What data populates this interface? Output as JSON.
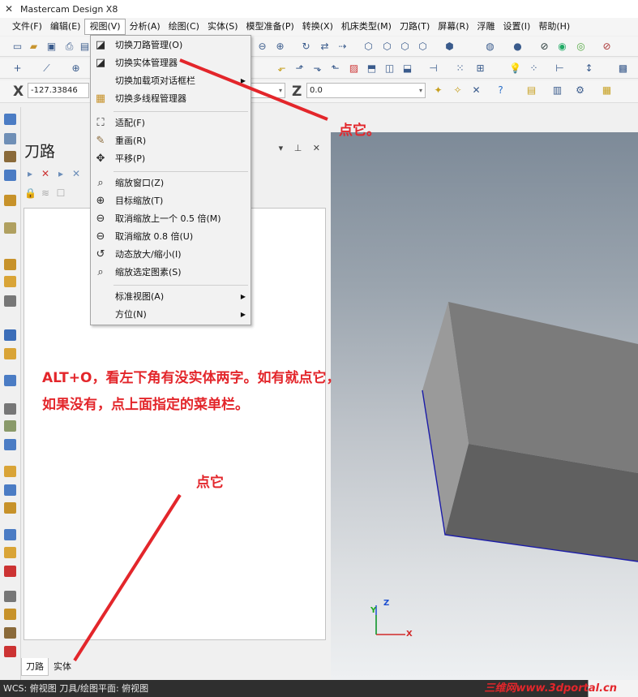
{
  "app": {
    "title": "Mastercam Design X8",
    "icon": "mastercam-x-icon"
  },
  "menu": [
    "文件(F)",
    "编辑(E)",
    "视图(V)",
    "分析(A)",
    "绘图(C)",
    "实体(S)",
    "模型准备(P)",
    "转换(X)",
    "机床类型(M)",
    "刀路(T)",
    "屏幕(R)",
    "浮雕",
    "设置(I)",
    "帮助(H)"
  ],
  "coords": {
    "x_label": "X",
    "x_value": "-127.33846",
    "z_label": "Z",
    "z_value": "0.0"
  },
  "view_menu": {
    "items": [
      {
        "label": "切换刀路管理(O)",
        "icon": "toolpath-manager-icon"
      },
      {
        "label": "切换实体管理器",
        "icon": "solids-manager-icon"
      },
      {
        "label": "切换加载项对话框栏",
        "icon": "",
        "submenu": true
      },
      {
        "label": "切换多线程管理器",
        "icon": "multithread-manager-icon"
      },
      {
        "label": "适配(F)",
        "icon": "fit-icon"
      },
      {
        "label": "重画(R)",
        "icon": "repaint-icon"
      },
      {
        "label": "平移(P)",
        "icon": "pan-icon"
      },
      {
        "label": "缩放窗口(Z)",
        "icon": "zoom-window-icon"
      },
      {
        "label": "目标缩放(T)",
        "icon": "zoom-target-icon"
      },
      {
        "label": "取消缩放上一个 0.5 倍(M)",
        "icon": "unzoom-previous-icon"
      },
      {
        "label": "取消缩放 0.8 倍(U)",
        "icon": "unzoom-icon"
      },
      {
        "label": "动态放大/缩小(I)",
        "icon": "dynamic-zoom-icon"
      },
      {
        "label": "缩放选定图素(S)",
        "icon": "zoom-selected-icon"
      },
      {
        "label": "标准视图(A)",
        "icon": "",
        "submenu": true
      },
      {
        "label": "方位(N)",
        "icon": "",
        "submenu": true
      }
    ]
  },
  "panel": {
    "title": "刀路",
    "tabs": [
      "刀路",
      "实体"
    ]
  },
  "status": {
    "text": "WCS: 俯视图  刀具/绘图平面: 俯视图"
  },
  "annotations": {
    "a1": "点它。",
    "a2_line1": "ALT+O，看左下角有没实体两字。如有就点它，",
    "a2_line2": "如果没有，点上面指定的菜单栏。",
    "a3": "点它"
  },
  "triad": {
    "x": "X",
    "y": "Y",
    "z": "Z"
  },
  "watermark": "三维网www.3dportal.cn",
  "colors": {
    "annotation": "#e3262b",
    "viewport_top": "#7d8a98",
    "viewport_bottom": "#eef0f2",
    "cube_edge": "#1c1ca8"
  }
}
